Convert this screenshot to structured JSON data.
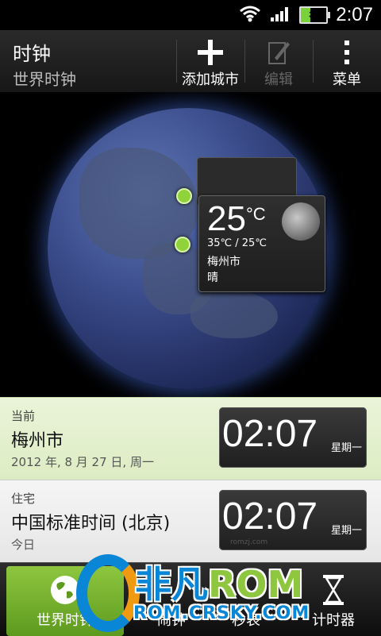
{
  "status_bar": {
    "time": "2:07",
    "battery_level": "36"
  },
  "header": {
    "title": "时钟",
    "subtitle": "世界时钟",
    "add_label": "添加城市",
    "edit_label": "编辑",
    "menu_label": "菜单"
  },
  "weather": {
    "temp": "25",
    "unit": "°C",
    "hilo": "35℃ / 25℃",
    "city": "梅州市",
    "condition": "晴"
  },
  "rows": [
    {
      "label": "当前",
      "city": "梅州市",
      "date": "2012 年, 8 月 27 日, 周一",
      "time": "02:07",
      "day": "星期一"
    },
    {
      "label": "住宅",
      "city": "中国标准时间 (北京)",
      "date": "今日",
      "time": "02:07",
      "day": "星期一"
    }
  ],
  "tabs": {
    "world": "世界时钟",
    "alarm": "闹钟",
    "stopwatch": "秒表",
    "timer": "计时器"
  },
  "watermark": {
    "line1a": "非凡",
    "line1b": "ROM",
    "line2": "ROM.CRSKY.COM",
    "site": "romzj.com"
  },
  "colors": {
    "accent_green": "#8ec63f",
    "row_current_bg": "#eaf4d9"
  }
}
